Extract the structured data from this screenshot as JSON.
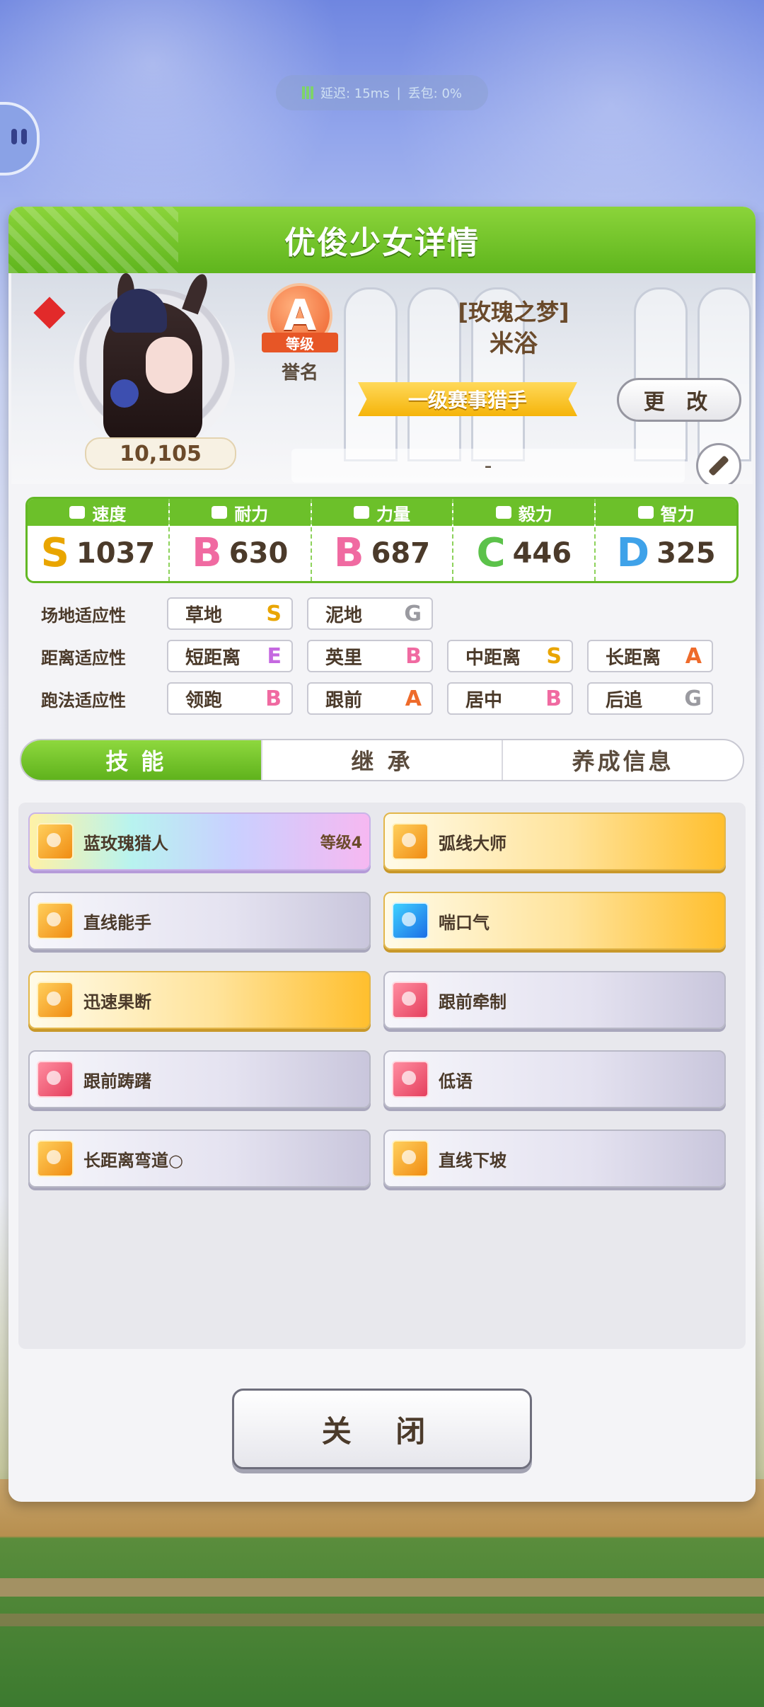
{
  "status": {
    "latency": "延迟: 15ms",
    "loss": "丢包: 0%"
  },
  "panel": {
    "title": "优俊少女详情"
  },
  "profile": {
    "fans": "10,105",
    "rank_letter": "A",
    "rank_ribbon": "等级",
    "rank_sub": "誉名",
    "epithet": "[玫瑰之梦]",
    "name": "米浴",
    "title_label": "一级赛事猎手",
    "change_label": "更 改",
    "comment": "-"
  },
  "stats": [
    {
      "label": "速度",
      "grade": "S",
      "value": "1037"
    },
    {
      "label": "耐力",
      "grade": "B",
      "value": "630"
    },
    {
      "label": "力量",
      "grade": "B",
      "value": "687"
    },
    {
      "label": "毅力",
      "grade": "C",
      "value": "446"
    },
    {
      "label": "智力",
      "grade": "D",
      "value": "325"
    }
  ],
  "aptitude": {
    "surface": {
      "label": "场地适应性",
      "items": [
        {
          "name": "草地",
          "grade": "S"
        },
        {
          "name": "泥地",
          "grade": "G"
        }
      ]
    },
    "distance": {
      "label": "距离适应性",
      "items": [
        {
          "name": "短距离",
          "grade": "E"
        },
        {
          "name": "英里",
          "grade": "B"
        },
        {
          "name": "中距离",
          "grade": "S"
        },
        {
          "name": "长距离",
          "grade": "A"
        }
      ]
    },
    "style": {
      "label": "跑法适应性",
      "items": [
        {
          "name": "领跑",
          "grade": "B"
        },
        {
          "name": "跟前",
          "grade": "A"
        },
        {
          "name": "居中",
          "grade": "B"
        },
        {
          "name": "后追",
          "grade": "G"
        }
      ]
    }
  },
  "tabs": [
    "技能",
    "继 承",
    "养成信息"
  ],
  "skills": [
    {
      "name": "蓝玫瑰猎人",
      "level": "等级4",
      "style": "rainbow",
      "icon": "gold"
    },
    {
      "name": "弧线大师",
      "level": "",
      "style": "gold",
      "icon": "gold"
    },
    {
      "name": "直线能手",
      "level": "",
      "style": "gray",
      "icon": "gold"
    },
    {
      "name": "喘口气",
      "level": "",
      "style": "gold",
      "icon": "blue"
    },
    {
      "name": "迅速果断",
      "level": "",
      "style": "gold",
      "icon": "gold"
    },
    {
      "name": "跟前牵制",
      "level": "",
      "style": "gray",
      "icon": "red"
    },
    {
      "name": "跟前踌躇",
      "level": "",
      "style": "gray",
      "icon": "red"
    },
    {
      "name": "低语",
      "level": "",
      "style": "gray",
      "icon": "red"
    },
    {
      "name": "长距离弯道○",
      "level": "",
      "style": "gray",
      "icon": "gold"
    },
    {
      "name": "直线下坡",
      "level": "",
      "style": "gray",
      "icon": "gold"
    }
  ],
  "close_label": "关 闭"
}
